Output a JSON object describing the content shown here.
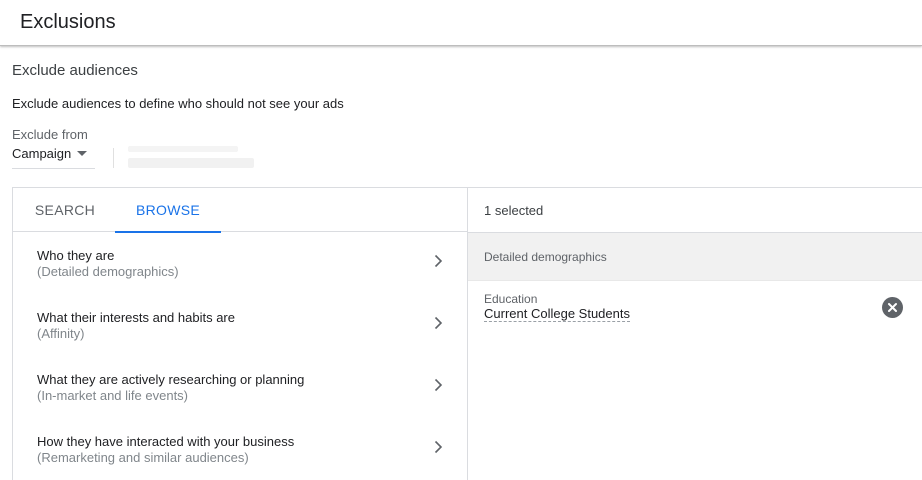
{
  "header": {
    "title": "Exclusions"
  },
  "section": {
    "title": "Exclude audiences",
    "description": "Exclude audiences to define who should not see your ads"
  },
  "exclude_from": {
    "label": "Exclude from",
    "value": "Campaign"
  },
  "tabs": [
    {
      "label": "SEARCH",
      "active": false
    },
    {
      "label": "BROWSE",
      "active": true
    }
  ],
  "browse_items": [
    {
      "title": "Who they are",
      "subtitle": "(Detailed demographics)"
    },
    {
      "title": "What their interests and habits are",
      "subtitle": "(Affinity)"
    },
    {
      "title": "What they are actively researching or planning",
      "subtitle": "(In-market and life events)"
    },
    {
      "title": "How they have interacted with your business",
      "subtitle": "(Remarketing and similar audiences)"
    }
  ],
  "selection": {
    "count_text": "1 selected",
    "group": "Detailed demographics",
    "items": [
      {
        "category": "Education",
        "value": "Current College Students"
      }
    ]
  },
  "icons": {
    "dropdown": "caret-down-icon",
    "browse_chevron": "chevron-right-icon",
    "remove": "remove-circle-icon"
  },
  "colors": {
    "accent": "#1a73e8",
    "muted_text": "#5f6368",
    "group_header_bg": "#f1f1f1",
    "remove_icon_bg": "#5f6368"
  }
}
